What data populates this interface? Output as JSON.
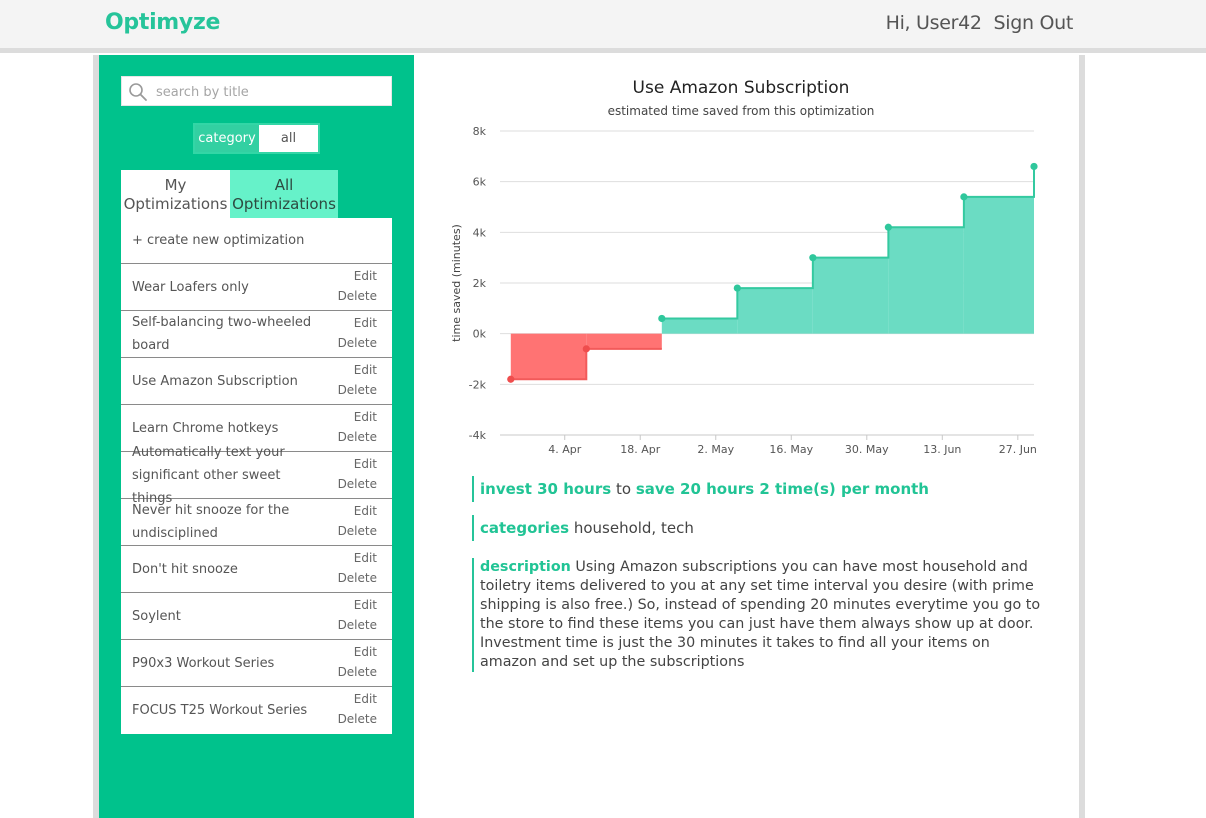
{
  "header": {
    "brand": "Optimyze",
    "greeting": "Hi, User42",
    "signout": "Sign Out"
  },
  "sidebar": {
    "search_placeholder": "search by title",
    "category_label": "category",
    "category_value": "all",
    "tabs": [
      {
        "label_line1": "My",
        "label_line2": "Optimizations"
      },
      {
        "label_line1": "All",
        "label_line2": "Optimizations"
      }
    ],
    "create_label": "+ create new optimization",
    "edit_label": "Edit",
    "delete_label": "Delete",
    "items": [
      {
        "title": "Wear Loafers only"
      },
      {
        "title": "Self-balancing two-wheeled board"
      },
      {
        "title": "Use Amazon Subscription"
      },
      {
        "title": "Learn Chrome hotkeys"
      },
      {
        "title": "Automatically text your significant other sweet things"
      },
      {
        "title": "Never hit snooze for the undisciplined"
      },
      {
        "title": "Don't hit snooze"
      },
      {
        "title": "Soylent"
      },
      {
        "title": "P90x3 Workout Series"
      },
      {
        "title": "FOCUS T25 Workout Series"
      }
    ]
  },
  "colors": {
    "accent": "#00c28c",
    "negative": "#ff7373",
    "positive": "#6bdcc3"
  },
  "chart_data": {
    "type": "area",
    "title": "Use Amazon Subscription",
    "subtitle": "estimated time saved from this optimization",
    "ylabel": "time saved (minutes)",
    "xlabel": "",
    "ylim": [
      -4000,
      8000
    ],
    "yticks": [
      "-4k",
      "-2k",
      "0k",
      "2k",
      "4k",
      "6k",
      "8k"
    ],
    "ytick_values": [
      -4000,
      -2000,
      0,
      2000,
      4000,
      6000,
      8000
    ],
    "xlim": [
      "2014-03-23",
      "2014-06-30"
    ],
    "xtick_dates": [
      "2014-04-04",
      "2014-04-18",
      "2014-05-02",
      "2014-05-16",
      "2014-05-30",
      "2014-06-13",
      "2014-06-27"
    ],
    "xticks": [
      "4. Apr",
      "18. Apr",
      "2. May",
      "16. May",
      "30. May",
      "13. Jun",
      "27. Jun"
    ],
    "step": true,
    "grid": true,
    "points": [
      {
        "x": "2014-03-25",
        "y": -1800
      },
      {
        "x": "2014-04-08",
        "y": -600
      },
      {
        "x": "2014-04-22",
        "y": 600
      },
      {
        "x": "2014-05-06",
        "y": 1800
      },
      {
        "x": "2014-05-20",
        "y": 3000
      },
      {
        "x": "2014-06-03",
        "y": 4200
      },
      {
        "x": "2014-06-17",
        "y": 5400
      },
      {
        "x": "2014-06-30",
        "y": 6600
      }
    ]
  },
  "details": {
    "invest_text": "invest 30 hours",
    "to_text": "to",
    "save_text": "save 20 hours 2 time(s) per month",
    "categories_label": "categories",
    "categories_value": "household, tech",
    "description_label": "description",
    "description_text": "Using Amazon subscriptions you can have most household and toiletry items delivered to you at any set time interval you desire (with prime shipping is also free.) So, instead of spending 20 minutes everytime you go to the store to find these items you can just have them always show up at door. Investment time is just the 30 minutes it takes to find all your items on amazon and set up the subscriptions"
  }
}
